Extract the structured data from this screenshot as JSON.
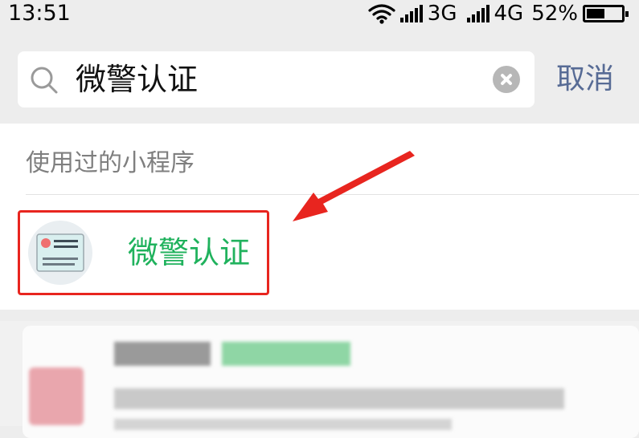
{
  "status_bar": {
    "time": "13:51",
    "network_1": "3G",
    "network_2": "4G",
    "battery_percent": "52%",
    "battery_level": 0.52,
    "icons": [
      "wifi-icon",
      "signal-icon",
      "signal-icon",
      "battery-icon"
    ]
  },
  "search": {
    "query": "微警认证",
    "cancel_label": "取消"
  },
  "recent_section": {
    "title": "使用过的小程序",
    "items": [
      {
        "name": "微警认证",
        "icon": "id-card-icon"
      }
    ]
  },
  "colors": {
    "background": "#ededed",
    "accent_green": "#20b25d",
    "cancel_link": "#576b95",
    "highlight_red": "#e8251f"
  }
}
